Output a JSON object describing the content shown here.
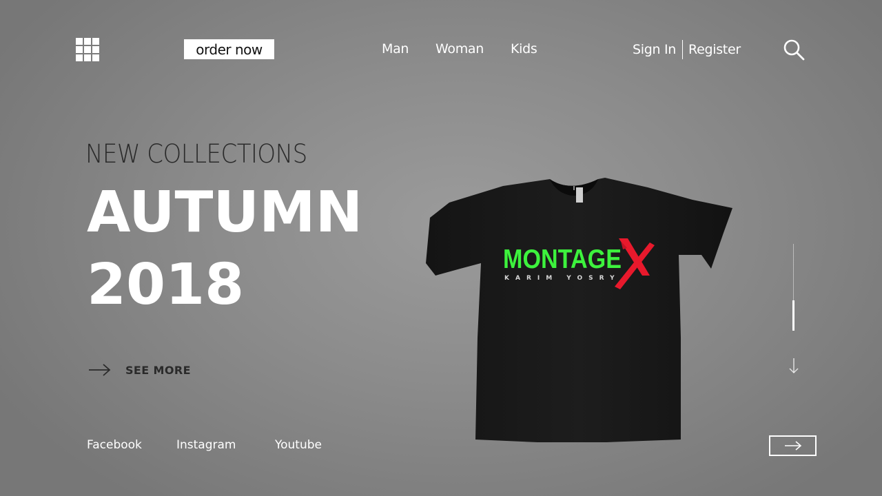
{
  "header": {
    "menu_icon": "grid-menu-icon",
    "order_label": "order now",
    "nav": [
      "Man",
      "Woman",
      "Kids"
    ],
    "sign_in": "Sign In",
    "register": "Register",
    "search_icon": "search-icon"
  },
  "hero": {
    "eyebrow": "NEW COLLECTIONS",
    "title": "AUTUMN",
    "year": "2018",
    "see_more": "SEE MORE"
  },
  "product": {
    "brand": "MONTAGE",
    "brand_mark": "X",
    "designer": "KARIM YOSRY",
    "brand_color": "#3df23d",
    "mark_color": "#e8192c"
  },
  "social": [
    "Facebook",
    "Instagram",
    "Youtube"
  ],
  "slider": {
    "progress": 0.65
  },
  "colors": {
    "accent": "#ffffff",
    "dark_text": "#2a2a2a"
  }
}
